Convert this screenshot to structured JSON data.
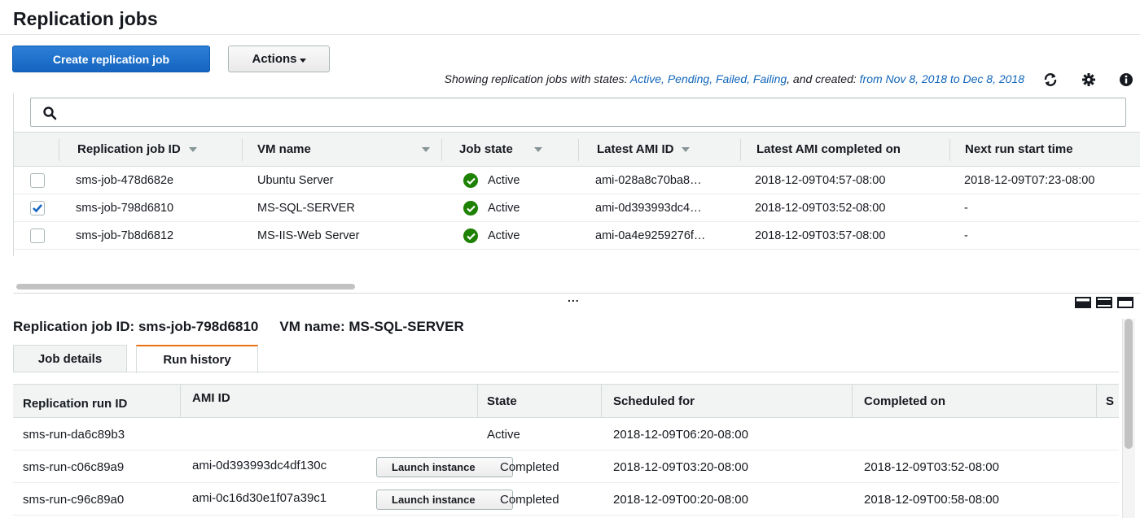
{
  "page_title": "Replication jobs",
  "toolbar": {
    "create_label": "Create replication job",
    "actions_label": "Actions"
  },
  "filter": {
    "prefix": "Showing replication jobs with states: ",
    "states": "Active, Pending, Failed, Failing",
    "middle": ", and created: ",
    "range": "from Nov 8, 2018 to Dec 8, 2018"
  },
  "icons": {
    "refresh": "refresh-icon",
    "settings": "gear-icon",
    "info": "info-icon",
    "search": "search-icon",
    "status_ok": "check-circle-icon"
  },
  "search": {
    "placeholder": ""
  },
  "jobs_table": {
    "columns": [
      "Replication job ID",
      "VM name",
      "Job state",
      "Latest AMI ID",
      "Latest AMI completed on",
      "Next run start time"
    ],
    "rows": [
      {
        "checked": false,
        "job_id": "sms-job-478d682e",
        "vm_name": "Ubuntu Server",
        "state": "Active",
        "ami_id": "ami-028a8c70ba8…",
        "completed": "2018-12-09T04:57-08:00",
        "next_run": "2018-12-09T07:23-08:00"
      },
      {
        "checked": true,
        "job_id": "sms-job-798d6810",
        "vm_name": "MS-SQL-SERVER",
        "state": "Active",
        "ami_id": "ami-0d393993dc4…",
        "completed": "2018-12-09T03:52-08:00",
        "next_run": "-"
      },
      {
        "checked": false,
        "job_id": "sms-job-7b8d6812",
        "vm_name": "MS-IIS-Web Server",
        "state": "Active",
        "ami_id": "ami-0a4e9259276f…",
        "completed": "2018-12-09T03:57-08:00",
        "next_run": "-"
      }
    ]
  },
  "split_handle": "...",
  "details": {
    "job_id_label": "Replication job ID: ",
    "job_id": "sms-job-798d6810",
    "vm_label": "VM name: ",
    "vm_name": "MS-SQL-SERVER",
    "tabs": [
      "Job details",
      "Run history"
    ],
    "active_tab": "Run history"
  },
  "runs_table": {
    "columns": [
      "Replication run ID",
      "AMI ID",
      "State",
      "Scheduled for",
      "Completed on",
      "S"
    ],
    "rows": [
      {
        "run_id": "sms-run-da6c89b3",
        "ami_id": "",
        "launch": "",
        "state": "Active",
        "scheduled": "2018-12-09T06:20-08:00",
        "completed": ""
      },
      {
        "run_id": "sms-run-c06c89a9",
        "ami_id": "ami-0d393993dc4df130c",
        "launch": "Launch instance",
        "state": "Completed",
        "scheduled": "2018-12-09T03:20-08:00",
        "completed": "2018-12-09T03:52-08:00"
      },
      {
        "run_id": "sms-run-c96c89a0",
        "ami_id": "ami-0c16d30e1f07a39c1",
        "launch": "Launch instance",
        "state": "Completed",
        "scheduled": "2018-12-09T00:20-08:00",
        "completed": "2018-12-09T00:58-08:00"
      }
    ]
  },
  "colors": {
    "primary": "#1565c0",
    "link": "#1166bb",
    "success": "#1d8102",
    "tab_accent": "#ec7211"
  }
}
